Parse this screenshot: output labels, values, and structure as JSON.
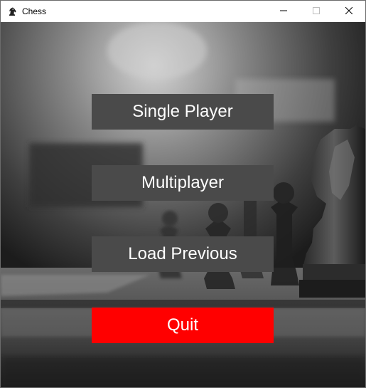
{
  "window": {
    "title": "Chess",
    "icons": {
      "app": "chess-knight-icon",
      "minimize": "minimize-icon",
      "maximize": "maximize-icon",
      "close": "close-icon"
    }
  },
  "menu": {
    "single_player_label": "Single Player",
    "multiplayer_label": "Multiplayer",
    "load_previous_label": "Load Previous",
    "quit_label": "Quit"
  },
  "colors": {
    "button_bg": "#4a4a4a",
    "quit_bg": "#ff0000",
    "button_text": "#ffffff"
  }
}
